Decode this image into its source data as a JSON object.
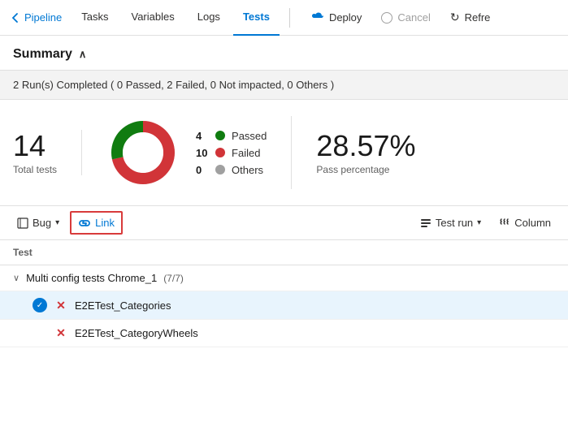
{
  "nav": {
    "back_label": "Pipeline",
    "items": [
      {
        "id": "tasks",
        "label": "Tasks",
        "active": false
      },
      {
        "id": "variables",
        "label": "Variables",
        "active": false
      },
      {
        "id": "logs",
        "label": "Logs",
        "active": false
      },
      {
        "id": "tests",
        "label": "Tests",
        "active": true
      }
    ],
    "deploy_label": "Deploy",
    "cancel_label": "Cancel",
    "refresh_label": "Refre"
  },
  "summary": {
    "title": "Summary",
    "run_status": "2 Run(s) Completed ( 0 Passed, 2 Failed, 0 Not impacted, 0 Others )",
    "total_tests": "14",
    "total_tests_label": "Total tests",
    "chart": {
      "passed_count": "4",
      "failed_count": "10",
      "others_count": "0",
      "passed_label": "Passed",
      "failed_label": "Failed",
      "others_label": "Others",
      "passed_color": "#107c10",
      "failed_color": "#d13438",
      "others_color": "#a0a0a0"
    },
    "pass_percentage": "28.57%",
    "pass_percentage_label": "Pass percentage"
  },
  "toolbar": {
    "bug_label": "Bug",
    "link_label": "Link",
    "test_run_label": "Test run",
    "column_label": "Column"
  },
  "table": {
    "column_header": "Test",
    "group": {
      "label": "Multi config tests Chrome_1",
      "count": "(7/7)"
    },
    "rows": [
      {
        "name": "E2ETest_Categories",
        "selected": true,
        "status": "failed"
      },
      {
        "name": "E2ETest_CategoryWheels",
        "selected": false,
        "status": "failed"
      }
    ]
  }
}
